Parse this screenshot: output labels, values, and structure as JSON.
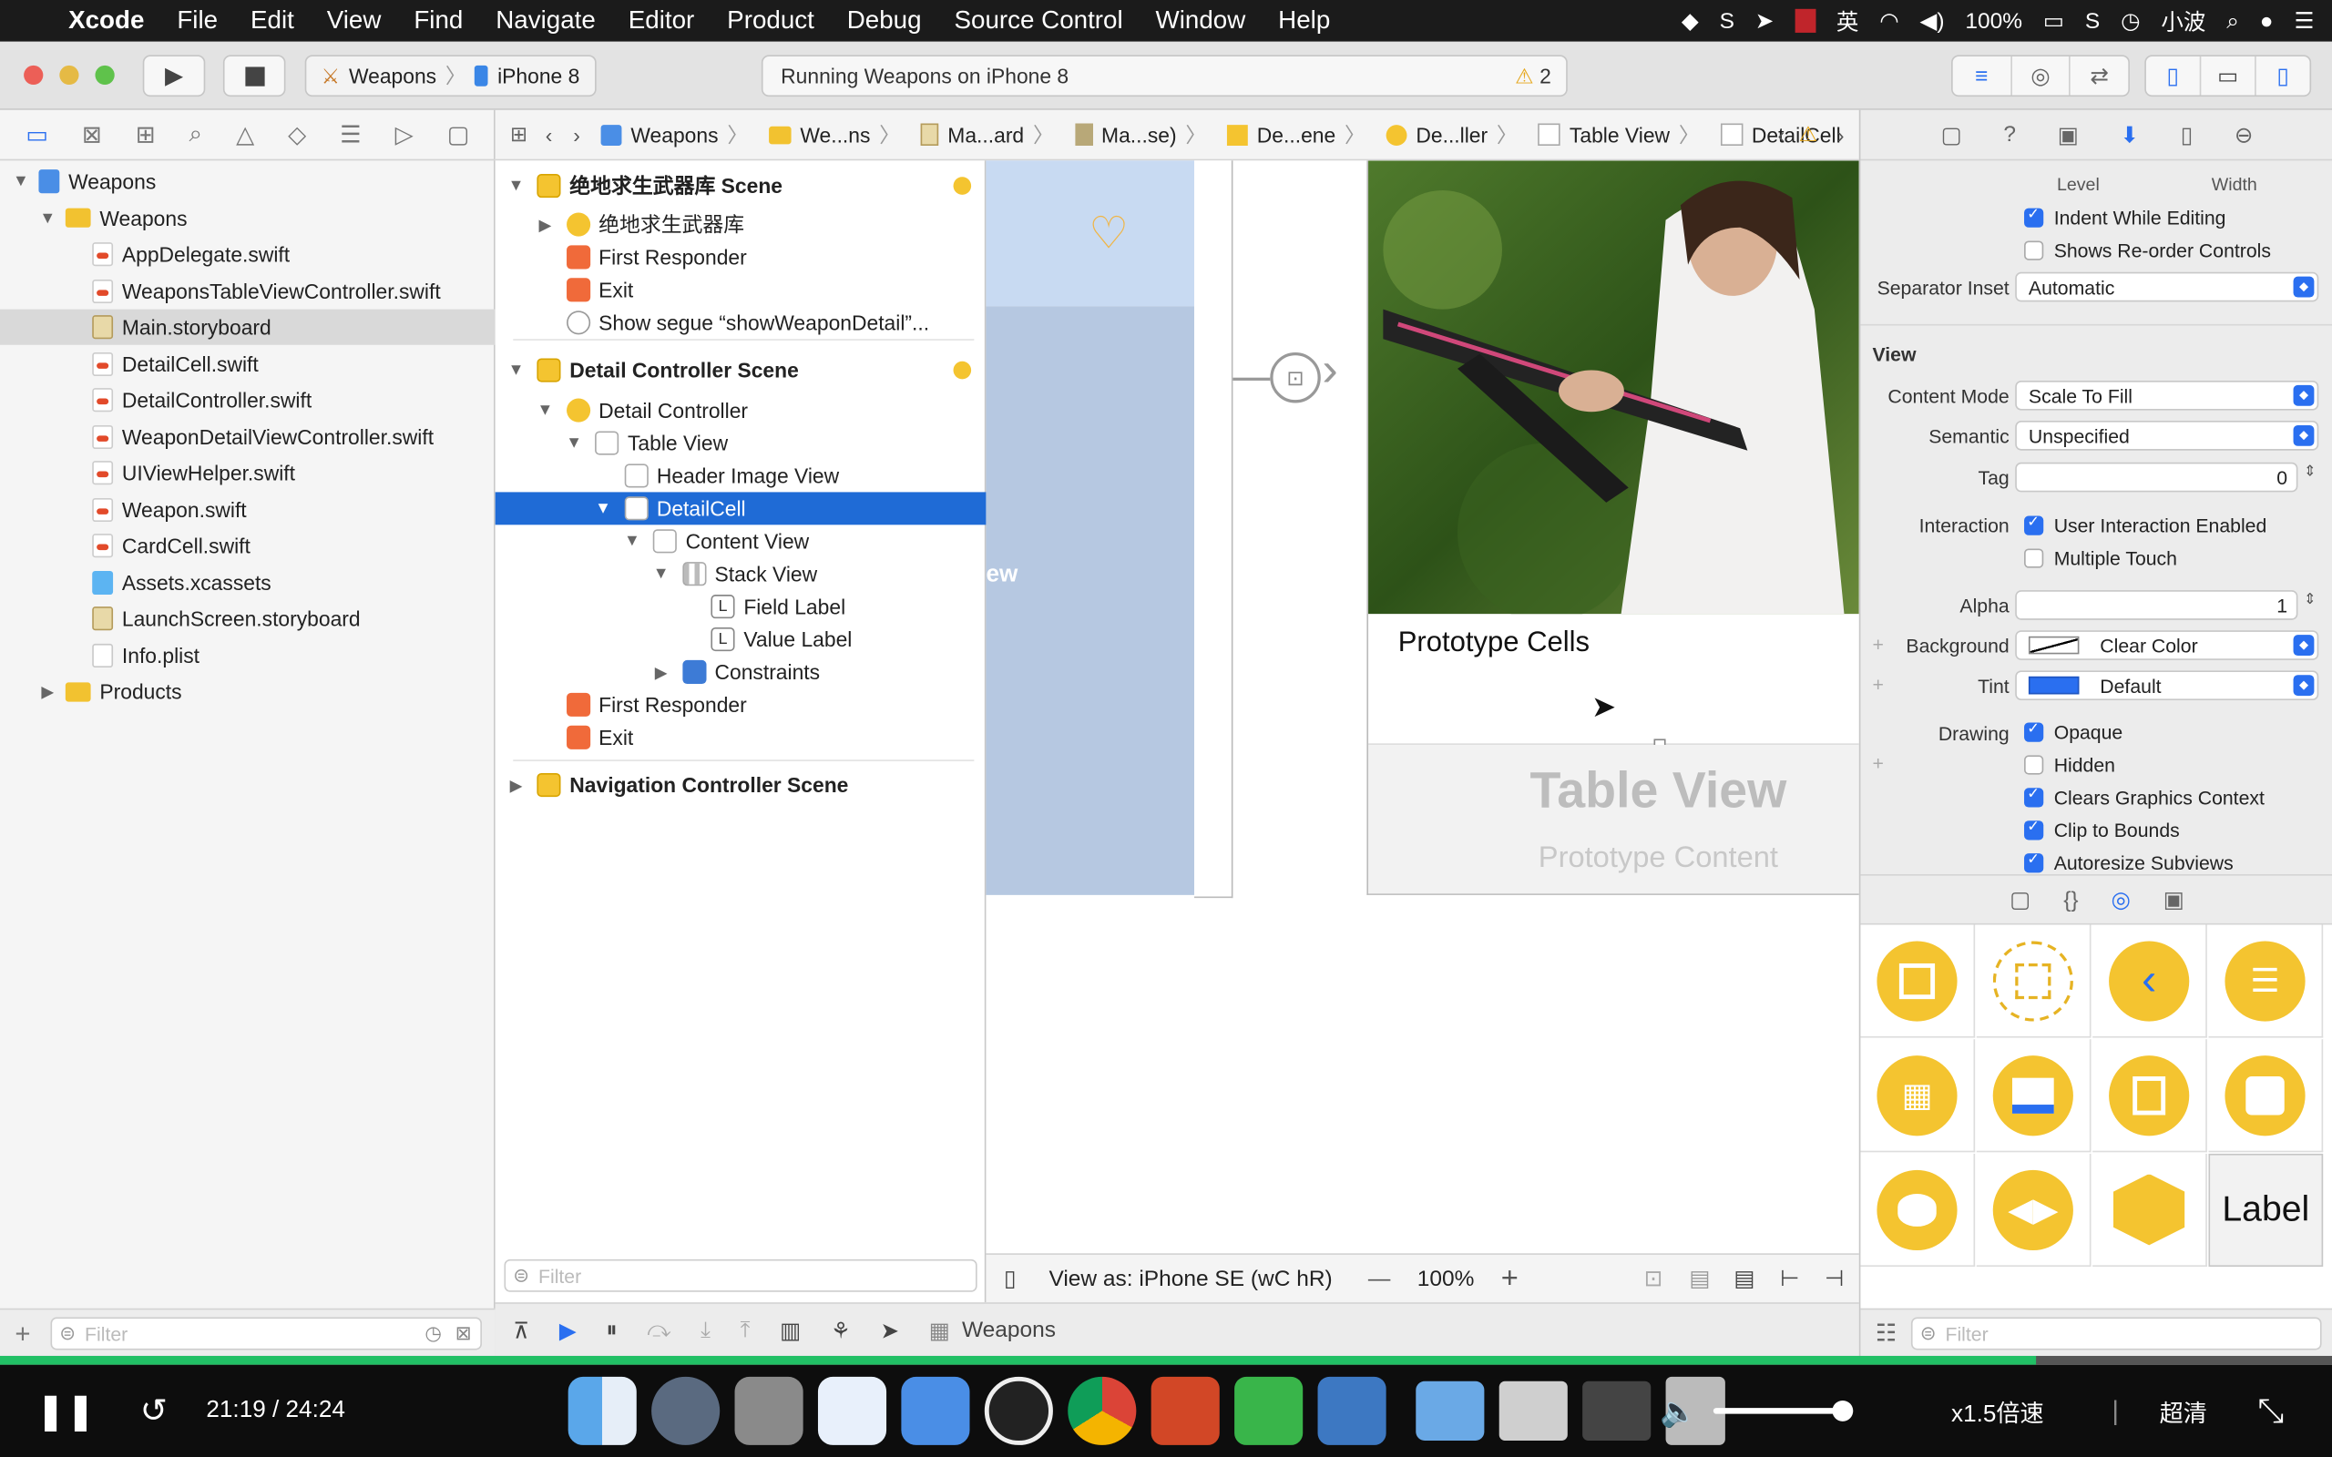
{
  "menubar": {
    "app": "Xcode",
    "items": [
      "File",
      "Edit",
      "View",
      "Find",
      "Navigate",
      "Editor",
      "Product",
      "Debug",
      "Source Control",
      "Window",
      "Help"
    ],
    "battery": "100%",
    "user": "小波"
  },
  "toolbar": {
    "scheme_target": "Weapons",
    "scheme_device": "iPhone 8",
    "status": "Running Weapons on iPhone 8",
    "warning_count": "2"
  },
  "navigator": {
    "rows": [
      {
        "label": "Weapons",
        "icon": "proj",
        "indent": 0,
        "disc": "▼"
      },
      {
        "label": "Weapons",
        "icon": "folder",
        "indent": 1,
        "disc": "▼"
      },
      {
        "label": "AppDelegate.swift",
        "icon": "swift",
        "indent": 2
      },
      {
        "label": "WeaponsTableViewController.swift",
        "icon": "swift",
        "indent": 2
      },
      {
        "label": "Main.storyboard",
        "icon": "sb",
        "indent": 2,
        "sel": true
      },
      {
        "label": "DetailCell.swift",
        "icon": "swift",
        "indent": 2
      },
      {
        "label": "DetailController.swift",
        "icon": "swift",
        "indent": 2
      },
      {
        "label": "WeaponDetailViewController.swift",
        "icon": "swift",
        "indent": 2
      },
      {
        "label": "UIViewHelper.swift",
        "icon": "swift",
        "indent": 2
      },
      {
        "label": "Weapon.swift",
        "icon": "swift",
        "indent": 2
      },
      {
        "label": "CardCell.swift",
        "icon": "swift",
        "indent": 2
      },
      {
        "label": "Assets.xcassets",
        "icon": "xcass",
        "indent": 2
      },
      {
        "label": "LaunchScreen.storyboard",
        "icon": "sb",
        "indent": 2
      },
      {
        "label": "Info.plist",
        "icon": "plist",
        "indent": 2
      },
      {
        "label": "Products",
        "icon": "folder",
        "indent": 1,
        "disc": "▶"
      }
    ],
    "filter_placeholder": "Filter"
  },
  "jumpbar": [
    "Weapons",
    "We...ns",
    "Ma...ard",
    "Ma...se)",
    "De...ene",
    "De...ller",
    "Table View",
    "DetailCell"
  ],
  "outline": {
    "rows": [
      {
        "label": "绝地求生武器库 Scene",
        "icon": "oi-scene",
        "indent": 0,
        "disc": "▼",
        "scene": true,
        "dot": true
      },
      {
        "label": "绝地求生武器库",
        "icon": "oi-ctrl",
        "indent": 1,
        "disc": "▶"
      },
      {
        "label": "First Responder",
        "icon": "oi-resp",
        "indent": 1
      },
      {
        "label": "Exit",
        "icon": "oi-exit",
        "indent": 1
      },
      {
        "label": "Show segue “showWeaponDetail”...",
        "icon": "oi-segue",
        "indent": 1
      },
      {
        "label": "Detail Controller Scene",
        "icon": "oi-scene",
        "indent": 0,
        "disc": "▼",
        "scene": true,
        "dot": true
      },
      {
        "label": "Detail Controller",
        "icon": "oi-ctrl",
        "indent": 1,
        "disc": "▼"
      },
      {
        "label": "Table View",
        "icon": "oi-view",
        "indent": 2,
        "disc": "▼"
      },
      {
        "label": "Header Image View",
        "icon": "oi-view",
        "indent": 3
      },
      {
        "label": "DetailCell",
        "icon": "oi-view",
        "indent": 3,
        "disc": "▼",
        "sel": true
      },
      {
        "label": "Content View",
        "icon": "oi-view",
        "indent": 4,
        "disc": "▼"
      },
      {
        "label": "Stack View",
        "icon": "oi-stack",
        "indent": 5,
        "disc": "▼"
      },
      {
        "label": "Field Label",
        "icon": "oi-label",
        "indent": 6
      },
      {
        "label": "Value Label",
        "icon": "oi-label",
        "indent": 6
      },
      {
        "label": "Constraints",
        "icon": "oi-cons",
        "indent": 5,
        "disc": "▶"
      },
      {
        "label": "First Responder",
        "icon": "oi-resp",
        "indent": 1
      },
      {
        "label": "Exit",
        "icon": "oi-exit",
        "indent": 1
      },
      {
        "label": "Navigation Controller Scene",
        "icon": "oi-scene",
        "indent": 0,
        "disc": "▶",
        "scene": true
      }
    ],
    "filter_placeholder": "Filter"
  },
  "canvas": {
    "left_fragment": "ew",
    "prototype_cells": "Prototype Cells",
    "table_view": "Table View",
    "prototype_content": "Prototype Content",
    "view_as": "View as: iPhone SE (wC hR)",
    "zoom": "100%",
    "tab_label": "Weapons"
  },
  "inspector": {
    "top_level_label": "Level",
    "top_width_label": "Width",
    "indent_editing": "Indent While Editing",
    "reorder": "Shows Re-order Controls",
    "separator_inset_label": "Separator Inset",
    "separator_inset": "Automatic",
    "section_view": "View",
    "content_mode_label": "Content Mode",
    "content_mode": "Scale To Fill",
    "semantic_label": "Semantic",
    "semantic": "Unspecified",
    "tag_label": "Tag",
    "tag": "0",
    "interaction_label": "Interaction",
    "user_interaction": "User Interaction Enabled",
    "multiple_touch": "Multiple Touch",
    "alpha_label": "Alpha",
    "alpha": "1",
    "background_label": "Background",
    "background": "Clear Color",
    "tint_label": "Tint",
    "tint": "Default",
    "drawing_label": "Drawing",
    "opaque": "Opaque",
    "hidden": "Hidden",
    "clears_graphics": "Clears Graphics Context",
    "clip_bounds": "Clip to Bounds",
    "autoresize": "Autoresize Subviews",
    "library_label": "Label",
    "filter_placeholder": "Filter"
  },
  "player": {
    "time": "21:19 / 24:24",
    "speed": "x1.5倍速",
    "quality": "超清",
    "progress": 0.873
  },
  "colors": {
    "accent": "#2a6ff0",
    "selection": "#1f6bd6",
    "yellow": "#f4c430"
  }
}
